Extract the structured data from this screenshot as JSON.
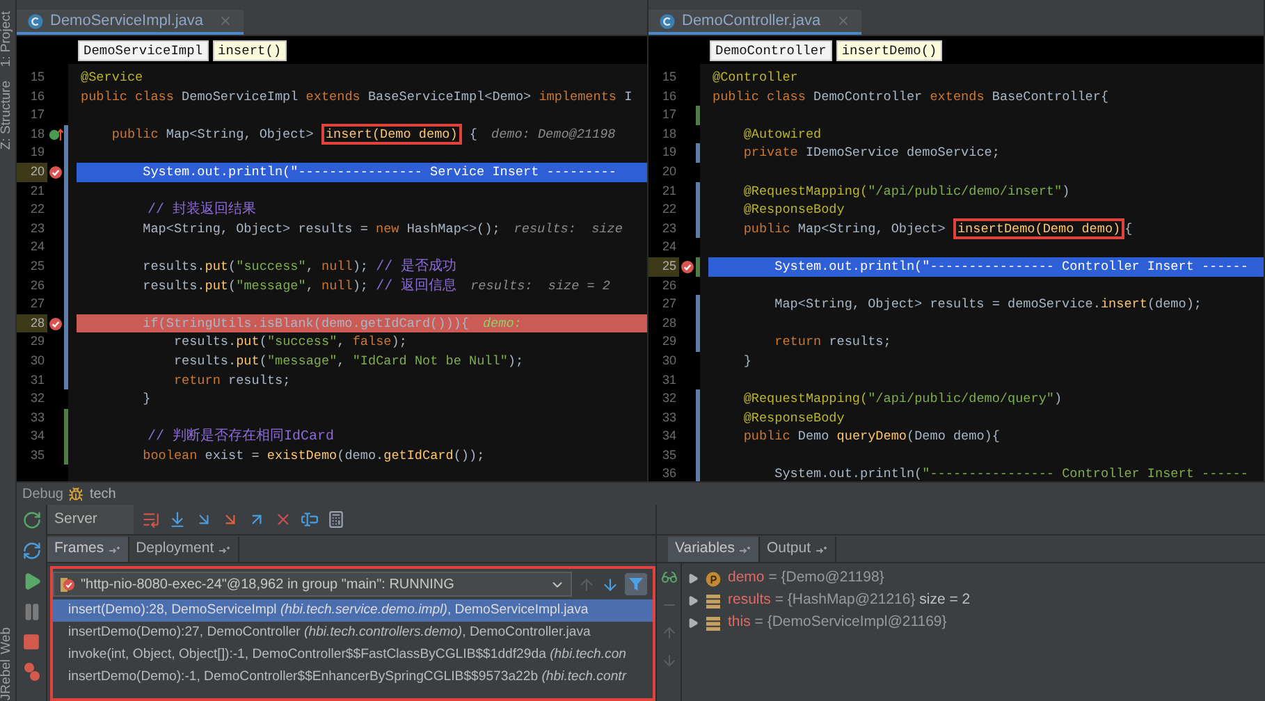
{
  "tool_strip": {
    "top": [
      {
        "label": "1: Project"
      },
      {
        "label": "Z: Structure"
      }
    ],
    "bottom": [
      {
        "label": "Web"
      },
      {
        "label": "JRebel"
      }
    ]
  },
  "editors": [
    {
      "file": "DemoServiceImpl.java",
      "breadcrumb": [
        {
          "label": "DemoServiceImpl",
          "kind": "class"
        },
        {
          "label": "insert()",
          "kind": "method"
        }
      ],
      "lines": [
        {
          "number": "15",
          "breakpoint": false,
          "execution_point": false,
          "implements": false,
          "modified": false,
          "added": false,
          "tokens": [
            {
              "text": "@Service",
              "kind": "annotation"
            }
          ]
        },
        {
          "number": "16",
          "breakpoint": false,
          "execution_point": false,
          "implements": false,
          "modified": false,
          "added": false,
          "tokens": [
            {
              "text": "public class ",
              "kind": "keyword"
            },
            {
              "text": "DemoServiceImpl ",
              "kind": "plain"
            },
            {
              "text": "extends ",
              "kind": "keyword"
            },
            {
              "text": "BaseServiceImpl<Demo> ",
              "kind": "plain"
            },
            {
              "text": "implements ",
              "kind": "keyword"
            },
            {
              "text": "I",
              "kind": "plain"
            }
          ]
        },
        {
          "number": "17",
          "breakpoint": false,
          "execution_point": false,
          "implements": false,
          "modified": false,
          "added": false
        },
        {
          "number": "18",
          "breakpoint": false,
          "execution_point": false,
          "implements": true,
          "modified": true,
          "added": false,
          "tokens": [
            {
              "text": "    public ",
              "kind": "keyword"
            },
            {
              "text": "Map<String, Object> ",
              "kind": "plain"
            },
            {
              "text": "insert(Demo demo)",
              "kind": "method",
              "boxed": true
            },
            {
              "text": " {",
              "kind": "plain"
            },
            {
              "text": "demo: Demo@21198",
              "kind": "hint"
            }
          ]
        },
        {
          "number": "19",
          "breakpoint": false,
          "execution_point": false,
          "implements": false,
          "modified": true,
          "added": false
        },
        {
          "number": "20",
          "breakpoint": true,
          "execution_point": true,
          "implements": false,
          "modified": true,
          "added": false,
          "tokens": [
            {
              "text": "        System.out.println(\"---------------- Service Insert ---------",
              "kind": "plain"
            }
          ]
        },
        {
          "number": "21",
          "breakpoint": false,
          "execution_point": false,
          "implements": false,
          "modified": true,
          "added": false
        },
        {
          "number": "22",
          "breakpoint": false,
          "execution_point": false,
          "implements": false,
          "modified": true,
          "added": false,
          "tokens": [
            {
              "text": "        // 封装返回结果",
              "kind": "comment"
            }
          ]
        },
        {
          "number": "23",
          "breakpoint": false,
          "execution_point": false,
          "implements": false,
          "modified": true,
          "added": false,
          "tokens": [
            {
              "text": "        Map<String, Object> results = ",
              "kind": "plain"
            },
            {
              "text": "new ",
              "kind": "keyword"
            },
            {
              "text": "HashMap<>();",
              "kind": "plain"
            },
            {
              "text": "results:  size",
              "kind": "hint"
            }
          ]
        },
        {
          "number": "24",
          "breakpoint": false,
          "execution_point": false,
          "implements": false,
          "modified": true,
          "added": false
        },
        {
          "number": "25",
          "breakpoint": false,
          "execution_point": false,
          "implements": false,
          "modified": true,
          "added": false,
          "tokens": [
            {
              "text": "        results.",
              "kind": "plain"
            },
            {
              "text": "put",
              "kind": "method"
            },
            {
              "text": "(",
              "kind": "plain"
            },
            {
              "text": "\"success\"",
              "kind": "string"
            },
            {
              "text": ", ",
              "kind": "plain"
            },
            {
              "text": "null",
              "kind": "keyword"
            },
            {
              "text": "); ",
              "kind": "plain"
            },
            {
              "text": "// 是否成功",
              "kind": "comment"
            }
          ]
        },
        {
          "number": "26",
          "breakpoint": false,
          "execution_point": false,
          "implements": false,
          "modified": true,
          "added": false,
          "tokens": [
            {
              "text": "        results.",
              "kind": "plain"
            },
            {
              "text": "put",
              "kind": "method"
            },
            {
              "text": "(",
              "kind": "plain"
            },
            {
              "text": "\"message\"",
              "kind": "string"
            },
            {
              "text": ", ",
              "kind": "plain"
            },
            {
              "text": "null",
              "kind": "keyword"
            },
            {
              "text": "); ",
              "kind": "plain"
            },
            {
              "text": "// 返回信息",
              "kind": "comment"
            },
            {
              "text": "results:  size = 2",
              "kind": "hint"
            }
          ]
        },
        {
          "number": "27",
          "breakpoint": false,
          "execution_point": false,
          "implements": false,
          "modified": true,
          "added": false
        },
        {
          "number": "28",
          "breakpoint": true,
          "execution_point": false,
          "implements": false,
          "modified": true,
          "added": false,
          "tokens": [
            {
              "text": "        if(StringUtils.isBlank(demo.getIdCard())){",
              "kind": "plain"
            },
            {
              "text": "demo:",
              "kind": "hint"
            }
          ]
        },
        {
          "number": "29",
          "breakpoint": false,
          "execution_point": false,
          "implements": false,
          "modified": true,
          "added": false,
          "tokens": [
            {
              "text": "            results.",
              "kind": "plain"
            },
            {
              "text": "put",
              "kind": "method"
            },
            {
              "text": "(",
              "kind": "plain"
            },
            {
              "text": "\"success\"",
              "kind": "string"
            },
            {
              "text": ", ",
              "kind": "plain"
            },
            {
              "text": "false",
              "kind": "keyword"
            },
            {
              "text": ");",
              "kind": "plain"
            }
          ]
        },
        {
          "number": "30",
          "breakpoint": false,
          "execution_point": false,
          "implements": false,
          "modified": true,
          "added": false,
          "tokens": [
            {
              "text": "            results.",
              "kind": "plain"
            },
            {
              "text": "put",
              "kind": "method"
            },
            {
              "text": "(",
              "kind": "plain"
            },
            {
              "text": "\"message\"",
              "kind": "string"
            },
            {
              "text": ", ",
              "kind": "plain"
            },
            {
              "text": "\"IdCard Not be Null\"",
              "kind": "string"
            },
            {
              "text": ");",
              "kind": "plain"
            }
          ]
        },
        {
          "number": "31",
          "breakpoint": false,
          "execution_point": false,
          "implements": false,
          "modified": true,
          "added": false,
          "tokens": [
            {
              "text": "            return ",
              "kind": "keyword"
            },
            {
              "text": "results;",
              "kind": "plain"
            }
          ]
        },
        {
          "number": "32",
          "breakpoint": false,
          "execution_point": false,
          "implements": false,
          "modified": false,
          "added": false,
          "tokens": [
            {
              "text": "        }",
              "kind": "plain"
            }
          ]
        },
        {
          "number": "33",
          "breakpoint": false,
          "execution_point": false,
          "implements": false,
          "modified": false,
          "added": true
        },
        {
          "number": "34",
          "breakpoint": false,
          "execution_point": false,
          "implements": false,
          "modified": false,
          "added": true,
          "tokens": [
            {
              "text": "        // 判断是否存在相同IdCard",
              "kind": "comment"
            }
          ]
        },
        {
          "number": "35",
          "breakpoint": false,
          "execution_point": false,
          "implements": false,
          "modified": false,
          "added": true,
          "tokens": [
            {
              "text": "        boolean ",
              "kind": "keyword"
            },
            {
              "text": "exist = ",
              "kind": "plain"
            },
            {
              "text": "existDemo",
              "kind": "method"
            },
            {
              "text": "(demo.",
              "kind": "plain"
            },
            {
              "text": "getIdCard",
              "kind": "method"
            },
            {
              "text": "());",
              "kind": "plain"
            }
          ]
        }
      ]
    },
    {
      "file": "DemoController.java",
      "breadcrumb": [
        {
          "label": "DemoController",
          "kind": "class"
        },
        {
          "label": "insertDemo()",
          "kind": "method"
        }
      ],
      "lines": [
        {
          "number": "15",
          "breakpoint": false,
          "execution_point": false,
          "implements": false,
          "modified": false,
          "added": false,
          "tokens": [
            {
              "text": "@Controller",
              "kind": "annotation"
            }
          ]
        },
        {
          "number": "16",
          "breakpoint": false,
          "execution_point": false,
          "implements": false,
          "modified": false,
          "added": false,
          "tokens": [
            {
              "text": "public class ",
              "kind": "keyword"
            },
            {
              "text": "DemoController ",
              "kind": "plain"
            },
            {
              "text": "extends ",
              "kind": "keyword"
            },
            {
              "text": "BaseController{",
              "kind": "plain"
            }
          ]
        },
        {
          "number": "17",
          "breakpoint": false,
          "execution_point": false,
          "implements": false,
          "modified": false,
          "added": true
        },
        {
          "number": "18",
          "breakpoint": false,
          "execution_point": false,
          "implements": false,
          "modified": false,
          "added": false,
          "tokens": [
            {
              "text": "    @Autowired",
              "kind": "annotation"
            }
          ]
        },
        {
          "number": "19",
          "breakpoint": false,
          "execution_point": false,
          "implements": false,
          "modified": true,
          "added": false,
          "tokens": [
            {
              "text": "    private ",
              "kind": "keyword"
            },
            {
              "text": "IDemoService demoService;",
              "kind": "plain"
            }
          ]
        },
        {
          "number": "20",
          "breakpoint": false,
          "execution_point": false,
          "implements": false,
          "modified": false,
          "added": false
        },
        {
          "number": "21",
          "breakpoint": false,
          "execution_point": false,
          "implements": false,
          "modified": true,
          "added": false,
          "tokens": [
            {
              "text": "    @RequestMapping(",
              "kind": "annotation"
            },
            {
              "text": "\"/api/public/demo/insert\"",
              "kind": "string"
            },
            {
              "text": ")",
              "kind": "plain"
            }
          ]
        },
        {
          "number": "22",
          "breakpoint": false,
          "execution_point": false,
          "implements": false,
          "modified": true,
          "added": false,
          "tokens": [
            {
              "text": "    @ResponseBody",
              "kind": "annotation"
            }
          ]
        },
        {
          "number": "23",
          "breakpoint": false,
          "execution_point": false,
          "implements": false,
          "modified": true,
          "added": false,
          "tokens": [
            {
              "text": "    public ",
              "kind": "keyword"
            },
            {
              "text": "Map<String, Object> ",
              "kind": "plain"
            },
            {
              "text": "insertDemo(Demo demo)",
              "kind": "method",
              "boxed": true
            },
            {
              "text": "{",
              "kind": "plain"
            }
          ]
        },
        {
          "number": "24",
          "breakpoint": false,
          "execution_point": false,
          "implements": false,
          "modified": false,
          "added": false
        },
        {
          "number": "25",
          "breakpoint": true,
          "execution_point": true,
          "implements": false,
          "modified": false,
          "added": true,
          "tokens": [
            {
              "text": "        System.out.println(\"---------------- Controller Insert ------",
              "kind": "plain"
            }
          ]
        },
        {
          "number": "26",
          "breakpoint": false,
          "execution_point": false,
          "implements": false,
          "modified": false,
          "added": false
        },
        {
          "number": "27",
          "breakpoint": false,
          "execution_point": false,
          "implements": false,
          "modified": true,
          "added": false,
          "tokens": [
            {
              "text": "        Map<String, Object> results = demoService.",
              "kind": "plain"
            },
            {
              "text": "insert",
              "kind": "method"
            },
            {
              "text": "(demo);",
              "kind": "plain"
            }
          ]
        },
        {
          "number": "28",
          "breakpoint": false,
          "execution_point": false,
          "implements": false,
          "modified": true,
          "added": false
        },
        {
          "number": "29",
          "breakpoint": false,
          "execution_point": false,
          "implements": false,
          "modified": true,
          "added": false,
          "tokens": [
            {
              "text": "        return ",
              "kind": "keyword"
            },
            {
              "text": "results;",
              "kind": "plain"
            }
          ]
        },
        {
          "number": "30",
          "breakpoint": false,
          "execution_point": false,
          "implements": false,
          "modified": false,
          "added": false,
          "tokens": [
            {
              "text": "    }",
              "kind": "plain"
            }
          ]
        },
        {
          "number": "31",
          "breakpoint": false,
          "execution_point": false,
          "implements": false,
          "modified": false,
          "added": false
        },
        {
          "number": "32",
          "breakpoint": false,
          "execution_point": false,
          "implements": false,
          "modified": true,
          "added": false,
          "tokens": [
            {
              "text": "    @RequestMapping(",
              "kind": "annotation"
            },
            {
              "text": "\"/api/public/demo/query\"",
              "kind": "string"
            },
            {
              "text": ")",
              "kind": "plain"
            }
          ]
        },
        {
          "number": "33",
          "breakpoint": false,
          "execution_point": false,
          "implements": false,
          "modified": true,
          "added": false,
          "tokens": [
            {
              "text": "    @ResponseBody",
              "kind": "annotation"
            }
          ]
        },
        {
          "number": "34",
          "breakpoint": false,
          "execution_point": false,
          "implements": false,
          "modified": true,
          "added": false,
          "tokens": [
            {
              "text": "    public ",
              "kind": "keyword"
            },
            {
              "text": "Demo ",
              "kind": "plain"
            },
            {
              "text": "queryDemo",
              "kind": "method"
            },
            {
              "text": "(Demo demo){",
              "kind": "plain"
            }
          ]
        },
        {
          "number": "35",
          "breakpoint": false,
          "execution_point": false,
          "implements": false,
          "modified": true,
          "added": false
        },
        {
          "number": "36",
          "breakpoint": false,
          "execution_point": false,
          "implements": false,
          "modified": true,
          "added": false,
          "tokens": [
            {
              "text": "        System.out.println(",
              "kind": "plain"
            },
            {
              "text": "\"---------------- Controller Insert ------",
              "kind": "string"
            }
          ]
        }
      ]
    }
  ],
  "debug": {
    "title": "Debug",
    "config": "tech",
    "session_tab": "Server",
    "left_tabs": [
      {
        "label": "Frames",
        "selected": true
      },
      {
        "label": "Deployment",
        "selected": false
      }
    ],
    "right_tabs": [
      {
        "label": "Variables",
        "selected": true
      },
      {
        "label": "Output",
        "selected": false
      }
    ],
    "thread": "\"http-nio-8080-exec-24\"@18,962 in group \"main\": RUNNING",
    "frames": [
      {
        "text": "insert(Demo):28, DemoServiceImpl *(hbi.tech.service.demo.impl)*, DemoServiceImpl.java",
        "selected": true
      },
      {
        "text": "insertDemo(Demo):27, DemoController *(hbi.tech.controllers.demo)*, DemoController.java",
        "selected": false
      },
      {
        "text": "invoke(int, Object, Object[]):-1, DemoController$$FastClassByCGLIB$$1ddf29da *(hbi.tech.con*",
        "selected": false
      },
      {
        "text": "insertDemo(Demo):-1, DemoController$$EnhancerBySpringCGLIB$$9573a22b *(hbi.tech.contr*",
        "selected": false
      }
    ],
    "variables": [
      {
        "name": "demo",
        "operator": "=",
        "value": "{Demo@21198}",
        "kind": "param"
      },
      {
        "name": "results",
        "operator": "=",
        "value": "{HashMap@21216}",
        "extra": "size = 2",
        "kind": "local"
      },
      {
        "name": "this",
        "operator": "=",
        "value": "{DemoServiceImpl@21169}",
        "kind": "local"
      }
    ]
  }
}
